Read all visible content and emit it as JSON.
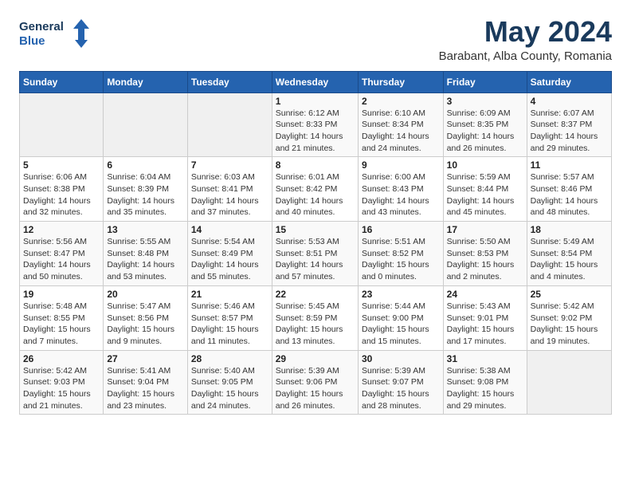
{
  "header": {
    "logo_line1": "General",
    "logo_line2": "Blue",
    "month": "May 2024",
    "location": "Barabant, Alba County, Romania"
  },
  "days_of_week": [
    "Sunday",
    "Monday",
    "Tuesday",
    "Wednesday",
    "Thursday",
    "Friday",
    "Saturday"
  ],
  "weeks": [
    [
      {
        "day": "",
        "info": ""
      },
      {
        "day": "",
        "info": ""
      },
      {
        "day": "",
        "info": ""
      },
      {
        "day": "1",
        "info": "Sunrise: 6:12 AM\nSunset: 8:33 PM\nDaylight: 14 hours\nand 21 minutes."
      },
      {
        "day": "2",
        "info": "Sunrise: 6:10 AM\nSunset: 8:34 PM\nDaylight: 14 hours\nand 24 minutes."
      },
      {
        "day": "3",
        "info": "Sunrise: 6:09 AM\nSunset: 8:35 PM\nDaylight: 14 hours\nand 26 minutes."
      },
      {
        "day": "4",
        "info": "Sunrise: 6:07 AM\nSunset: 8:37 PM\nDaylight: 14 hours\nand 29 minutes."
      }
    ],
    [
      {
        "day": "5",
        "info": "Sunrise: 6:06 AM\nSunset: 8:38 PM\nDaylight: 14 hours\nand 32 minutes."
      },
      {
        "day": "6",
        "info": "Sunrise: 6:04 AM\nSunset: 8:39 PM\nDaylight: 14 hours\nand 35 minutes."
      },
      {
        "day": "7",
        "info": "Sunrise: 6:03 AM\nSunset: 8:41 PM\nDaylight: 14 hours\nand 37 minutes."
      },
      {
        "day": "8",
        "info": "Sunrise: 6:01 AM\nSunset: 8:42 PM\nDaylight: 14 hours\nand 40 minutes."
      },
      {
        "day": "9",
        "info": "Sunrise: 6:00 AM\nSunset: 8:43 PM\nDaylight: 14 hours\nand 43 minutes."
      },
      {
        "day": "10",
        "info": "Sunrise: 5:59 AM\nSunset: 8:44 PM\nDaylight: 14 hours\nand 45 minutes."
      },
      {
        "day": "11",
        "info": "Sunrise: 5:57 AM\nSunset: 8:46 PM\nDaylight: 14 hours\nand 48 minutes."
      }
    ],
    [
      {
        "day": "12",
        "info": "Sunrise: 5:56 AM\nSunset: 8:47 PM\nDaylight: 14 hours\nand 50 minutes."
      },
      {
        "day": "13",
        "info": "Sunrise: 5:55 AM\nSunset: 8:48 PM\nDaylight: 14 hours\nand 53 minutes."
      },
      {
        "day": "14",
        "info": "Sunrise: 5:54 AM\nSunset: 8:49 PM\nDaylight: 14 hours\nand 55 minutes."
      },
      {
        "day": "15",
        "info": "Sunrise: 5:53 AM\nSunset: 8:51 PM\nDaylight: 14 hours\nand 57 minutes."
      },
      {
        "day": "16",
        "info": "Sunrise: 5:51 AM\nSunset: 8:52 PM\nDaylight: 15 hours\nand 0 minutes."
      },
      {
        "day": "17",
        "info": "Sunrise: 5:50 AM\nSunset: 8:53 PM\nDaylight: 15 hours\nand 2 minutes."
      },
      {
        "day": "18",
        "info": "Sunrise: 5:49 AM\nSunset: 8:54 PM\nDaylight: 15 hours\nand 4 minutes."
      }
    ],
    [
      {
        "day": "19",
        "info": "Sunrise: 5:48 AM\nSunset: 8:55 PM\nDaylight: 15 hours\nand 7 minutes."
      },
      {
        "day": "20",
        "info": "Sunrise: 5:47 AM\nSunset: 8:56 PM\nDaylight: 15 hours\nand 9 minutes."
      },
      {
        "day": "21",
        "info": "Sunrise: 5:46 AM\nSunset: 8:57 PM\nDaylight: 15 hours\nand 11 minutes."
      },
      {
        "day": "22",
        "info": "Sunrise: 5:45 AM\nSunset: 8:59 PM\nDaylight: 15 hours\nand 13 minutes."
      },
      {
        "day": "23",
        "info": "Sunrise: 5:44 AM\nSunset: 9:00 PM\nDaylight: 15 hours\nand 15 minutes."
      },
      {
        "day": "24",
        "info": "Sunrise: 5:43 AM\nSunset: 9:01 PM\nDaylight: 15 hours\nand 17 minutes."
      },
      {
        "day": "25",
        "info": "Sunrise: 5:42 AM\nSunset: 9:02 PM\nDaylight: 15 hours\nand 19 minutes."
      }
    ],
    [
      {
        "day": "26",
        "info": "Sunrise: 5:42 AM\nSunset: 9:03 PM\nDaylight: 15 hours\nand 21 minutes."
      },
      {
        "day": "27",
        "info": "Sunrise: 5:41 AM\nSunset: 9:04 PM\nDaylight: 15 hours\nand 23 minutes."
      },
      {
        "day": "28",
        "info": "Sunrise: 5:40 AM\nSunset: 9:05 PM\nDaylight: 15 hours\nand 24 minutes."
      },
      {
        "day": "29",
        "info": "Sunrise: 5:39 AM\nSunset: 9:06 PM\nDaylight: 15 hours\nand 26 minutes."
      },
      {
        "day": "30",
        "info": "Sunrise: 5:39 AM\nSunset: 9:07 PM\nDaylight: 15 hours\nand 28 minutes."
      },
      {
        "day": "31",
        "info": "Sunrise: 5:38 AM\nSunset: 9:08 PM\nDaylight: 15 hours\nand 29 minutes."
      },
      {
        "day": "",
        "info": ""
      }
    ]
  ]
}
